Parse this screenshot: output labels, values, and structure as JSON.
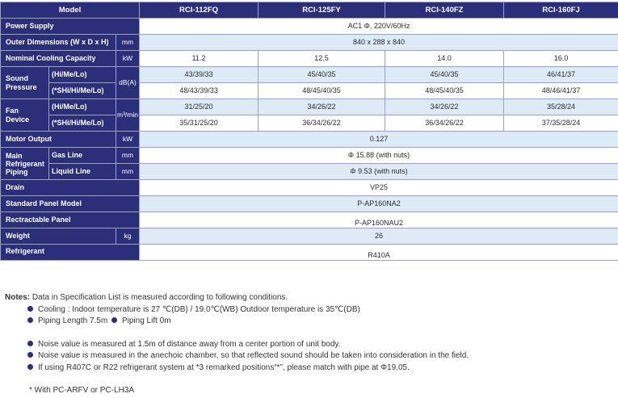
{
  "header": {
    "model": "Model",
    "col1": "RCI-112FQ",
    "col2": "RCI-125FY",
    "col3": "RCI-140FZ",
    "col4": "RCI-160FJ"
  },
  "rows": {
    "power": {
      "label": "Power Supply",
      "value": "AC1 Φ, 220V/60Hz"
    },
    "dims": {
      "label": "Outer Dimensions (W x D x H)",
      "unit": "mm",
      "value": "840 x 288 x 840"
    },
    "cooling": {
      "label": "Nominal Cooling Capacity",
      "unit": "kW",
      "values": [
        "11.2",
        "12.5",
        "14.0",
        "16.0"
      ]
    },
    "sound": {
      "label_line1": "Sound",
      "label_line2": "Pressure",
      "unit": "dB(A)",
      "sub1": "(Hi/Me/Lo)",
      "values1": [
        "43/39/33",
        "45/40/35",
        "45/40/35",
        "46/41/37"
      ],
      "sub2": "(*SHi/Hi/Me/Lo)",
      "values2": [
        "48/43/39/33",
        "48/45/40/35",
        "48/45/40/35",
        "48/46/41/37"
      ]
    },
    "fan": {
      "label_line1": "Fan",
      "label_line2": "Device",
      "unit": "m³/min",
      "sub1": "(Hi/Me/Lo)",
      "values1": [
        "31/25/20",
        "34/26/22",
        "34/26/22",
        "35/28/24"
      ],
      "sub2": "(*SHi/Hi/Me/Lo)",
      "values2": [
        "35/31/25/20",
        "36/34/26/22",
        "36/34/26/22",
        "37/35/28/24"
      ]
    },
    "motor": {
      "label": "Motor Output",
      "unit": "kW",
      "value": "0.127"
    },
    "piping": {
      "label_line1": "Main",
      "label_line2": "Refrigerant",
      "label_line3": "Piping",
      "gas_label": "Gas Line",
      "gas_unit": "mm",
      "gas_value": "Φ 15.88 (with nuts)",
      "liquid_label": "Liquid Line",
      "liquid_unit": "mm",
      "liquid_value": "Φ 9.53 (with nuts)"
    },
    "drain": {
      "label": "Drain",
      "value": "VP25"
    },
    "panel": {
      "label": "Standard Panel Model",
      "value": "P-AP160NA2"
    },
    "retract": {
      "label": "Rectractable Panel",
      "value": "P-AP160NAU2"
    },
    "weight": {
      "label": "Weight",
      "unit": "kg",
      "value": "26"
    },
    "refrigerant": {
      "label": "Refrigerant",
      "value": "R410A"
    }
  },
  "notes": {
    "heading": "Notes:",
    "intro": "Data in Specification List is measured according to following conditions.",
    "cooling": "Cooling : Indoor temperature is 27 ℃(DB) / 19.0℃(WB)   Outdoor temperature is 35℃(DB)",
    "piping_length": "Piping Length 7.5m",
    "piping_lift": "Piping Lift 0m",
    "noise1": "Noise value is measured at 1.5m of distance away from a center portion of unit body.",
    "noise2": "Noise value is measured in the anechoic chamber, so that reflected sound should be taken into consideration in the field.",
    "r407c": "If using R407C or R22 refrigerant system at *3 remarked positions“*”, please match with pipe at Φ19.05.",
    "footnote": "* With PC-ARFV or PC-LH3A"
  }
}
